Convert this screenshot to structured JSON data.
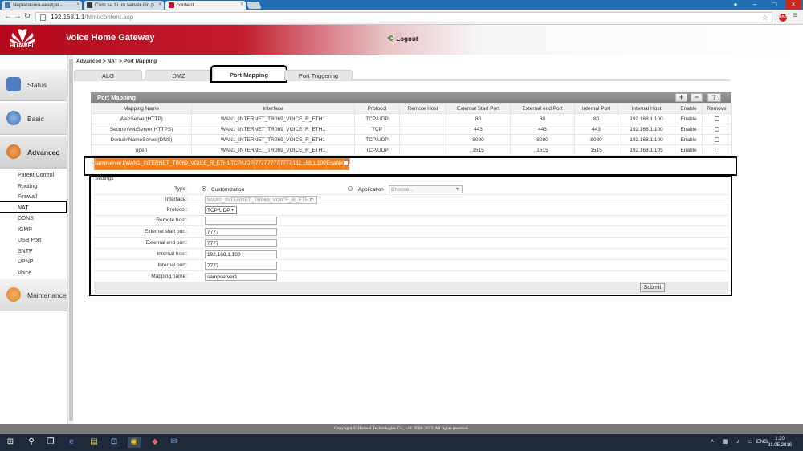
{
  "browser": {
    "tabs": [
      {
        "title": "Черепашки-ниндзя -",
        "favicon_color": "#4a76a8"
      },
      {
        "title": "Cum sa tii un server din p",
        "favicon_color": "#3a3a3a"
      },
      {
        "title": "content",
        "favicon_color": "#c8102e"
      }
    ],
    "url_host": "192.168.1.1",
    "url_path": "/html/content.asp",
    "ext_badge": "ABP"
  },
  "header": {
    "brand": "HUAWEI",
    "app_title": "Voice Home Gateway",
    "logout_label": "Logout"
  },
  "sidebar": {
    "menus": [
      {
        "label": "Status",
        "icon": "status-chart-icon",
        "color": "#4f7ec2"
      },
      {
        "label": "Basic",
        "icon": "globe-icon",
        "color": "#3d6fb0"
      },
      {
        "label": "Advanced",
        "icon": "gears-icon",
        "color": "#d06a1d"
      },
      {
        "label": "Maintenance",
        "icon": "user-icon",
        "color": "#e0862e"
      }
    ],
    "sub_items": [
      "Parent Control",
      "Routing",
      "Firewall",
      "NAT",
      "DDNS",
      "IGMP",
      "USB Port",
      "SNTP",
      "UPNP",
      "Voice"
    ],
    "active_sub": "NAT"
  },
  "breadcrumb": "Advanced > NAT > Port Mapping",
  "content_tabs": [
    "ALG",
    "DMZ",
    "Port Mapping",
    "Port Triggering"
  ],
  "active_tab": "Port Mapping",
  "port_mapping": {
    "title": "Port Mapping",
    "toolbar": {
      "add": "+",
      "remove": "−",
      "help": "?"
    },
    "columns": [
      "Mapping Name",
      "Interface",
      "Protocol",
      "Remote Host",
      "External Start Port",
      "External end Port",
      "Internal Port",
      "Internal Host",
      "Enable",
      "Remove"
    ],
    "rows": [
      {
        "name": "WebServer(HTTP)",
        "iface": "WAN1_INTERNET_TR069_VOICE_R_ETH1",
        "proto": "TCP/UDP",
        "remote": "",
        "ext_start": "80",
        "ext_end": "80",
        "int_port": "80",
        "int_host": "192.168.1.100",
        "enable": "Enable"
      },
      {
        "name": "SecureWebServer(HTTPS)",
        "iface": "WAN1_INTERNET_TR069_VOICE_R_ETH1",
        "proto": "TCP",
        "remote": "",
        "ext_start": "443",
        "ext_end": "443",
        "int_port": "443",
        "int_host": "192.168.1.100",
        "enable": "Enable"
      },
      {
        "name": "DomainNameServer(DNS)",
        "iface": "WAN1_INTERNET_TR069_VOICE_R_ETH1",
        "proto": "TCP/UDP",
        "remote": "",
        "ext_start": "8080",
        "ext_end": "8080",
        "int_port": "8080",
        "int_host": "192.168.1.100",
        "enable": "Enable"
      },
      {
        "name": "open",
        "iface": "WAN1_INTERNET_TR069_VOICE_R_ETH1",
        "proto": "TCP/UDP",
        "remote": "",
        "ext_start": "1515",
        "ext_end": "1515",
        "int_port": "1515",
        "int_host": "192.168.1.105",
        "enable": "Enable"
      },
      {
        "name": "sampserver1",
        "iface": "WAN1_INTERNET_TR069_VOICE_R_ETH1",
        "proto": "TCP/UDP",
        "remote": "",
        "ext_start": "7777",
        "ext_end": "7777",
        "int_port": "7777",
        "int_host": "192.168.1.100",
        "enable": "Enable"
      }
    ],
    "selected_row": 4,
    "selected_color": "#f07e1a"
  },
  "settings": {
    "title": "Settings",
    "type_label": "Type:",
    "type_custom": "Customization",
    "type_app": "Application",
    "app_placeholder": "Choose...",
    "interface_label": "Interface:",
    "interface_value": "WAN1_INTERNET_TR069_VOICE_R_ETH1",
    "protocol_label": "Protocol:",
    "protocol_value": "TCP/UDP",
    "fields": [
      {
        "label": "Remote host:",
        "value": ""
      },
      {
        "label": "External start port:",
        "value": "7777"
      },
      {
        "label": "External end port:",
        "value": "7777"
      },
      {
        "label": "Internal host:",
        "value": "192.168.1.100"
      },
      {
        "label": "Internal port:",
        "value": "7777"
      },
      {
        "label": "Mapping name:",
        "value": "sampserver1"
      }
    ],
    "submit_label": "Submit"
  },
  "footer": {
    "copyright": "Copyright © Huawei Technologies Co., Ltd. 2009-2013. All rights reserved."
  },
  "taskbar": {
    "lang": "ENG",
    "time": "1:20",
    "date": "31.05.2016"
  }
}
